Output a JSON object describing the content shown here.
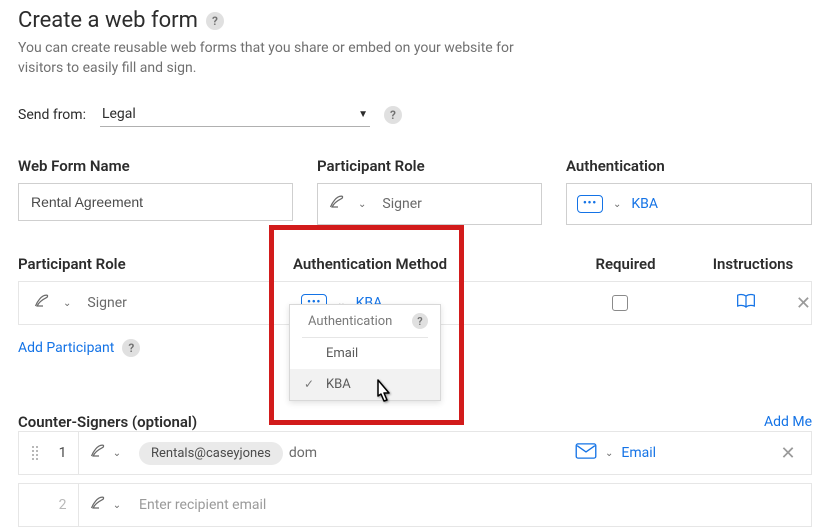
{
  "header": {
    "title": "Create a web form",
    "subtitle": "You can create reusable web forms that you share or embed on your website for visitors to easily fill and sign."
  },
  "send_from": {
    "label": "Send from:",
    "value": "Legal"
  },
  "row1": {
    "name_label": "Web Form Name",
    "name_value": "Rental Agreement",
    "role_label": "Participant Role",
    "role_value": "Signer",
    "auth_label": "Authentication",
    "auth_value": "KBA"
  },
  "row2": {
    "role_label": "Participant Role",
    "auth_label": "Authentication Method",
    "req_label": "Required",
    "inst_label": "Instructions",
    "role_value": "Signer",
    "auth_value": "KBA"
  },
  "add_participant": "Add Participant",
  "dropdown": {
    "header": "Authentication",
    "opt_email": "Email",
    "opt_kba": "KBA"
  },
  "cs": {
    "title": "Counter-Signers (optional)",
    "add_me": "Add Me",
    "rows": [
      {
        "num": "1",
        "email_chip": "Rentals@caseyjones",
        "email_tail": "dom",
        "auth": "Email"
      },
      {
        "num": "2",
        "placeholder": "Enter recipient email"
      }
    ]
  }
}
